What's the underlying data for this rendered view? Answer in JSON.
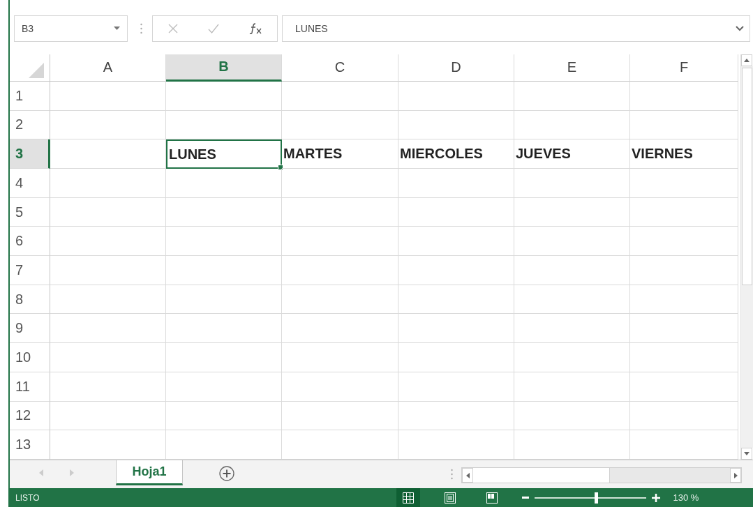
{
  "formula_bar": {
    "name_box": "B3",
    "formula": "LUNES"
  },
  "columns": [
    {
      "label": "A",
      "selected": false
    },
    {
      "label": "B",
      "selected": true
    },
    {
      "label": "C",
      "selected": false
    },
    {
      "label": "D",
      "selected": false
    },
    {
      "label": "E",
      "selected": false
    },
    {
      "label": "F",
      "selected": false
    }
  ],
  "rows": [
    {
      "number": "1",
      "selected": false
    },
    {
      "number": "2",
      "selected": false
    },
    {
      "number": "3",
      "selected": true,
      "cells": [
        {
          "selected": false
        },
        {
          "text": "LUNES",
          "selected": true
        },
        {
          "text": "MARTES",
          "selected": false
        },
        {
          "text": "MIERCOLES",
          "selected": false
        },
        {
          "text": "JUEVES",
          "selected": false
        },
        {
          "text": "VIERNES",
          "selected": false
        }
      ]
    },
    {
      "number": "4",
      "selected": false
    },
    {
      "number": "5",
      "selected": false
    },
    {
      "number": "6",
      "selected": false
    },
    {
      "number": "7",
      "selected": false
    },
    {
      "number": "8",
      "selected": false
    },
    {
      "number": "9",
      "selected": false
    },
    {
      "number": "10",
      "selected": false
    },
    {
      "number": "11",
      "selected": false
    },
    {
      "number": "12",
      "selected": false
    },
    {
      "number": "13",
      "selected": false
    }
  ],
  "sheet_tabs": [
    {
      "label": "Hoja1",
      "selected": true
    }
  ],
  "status_bar": {
    "status": "LISTO",
    "views": [
      {
        "kind": "normal",
        "selected": true
      },
      {
        "kind": "page_layout",
        "selected": false
      },
      {
        "kind": "page_break",
        "selected": false
      }
    ],
    "zoom": {
      "level": 0.55,
      "reading": "130 %"
    }
  }
}
